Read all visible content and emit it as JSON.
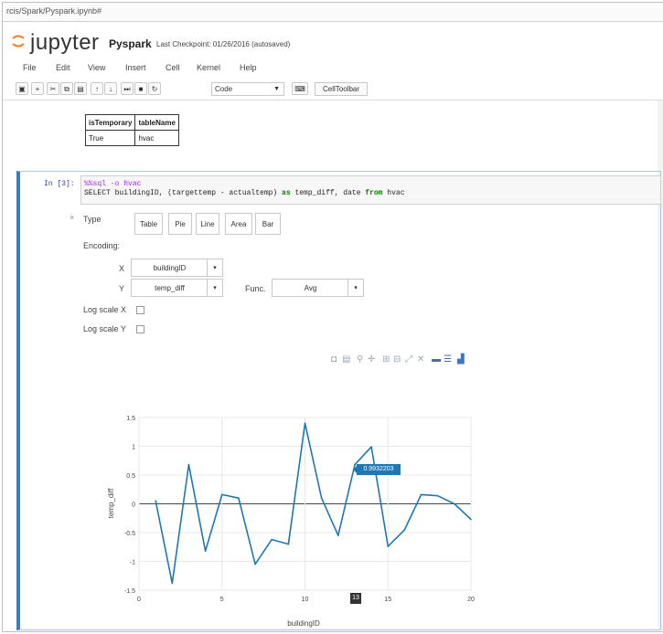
{
  "browser": {
    "url": "rcis/Spark/Pyspark.ipynb#"
  },
  "header": {
    "logo_text": "jupyter",
    "notebook_name": "Pyspark",
    "checkpoint": "Last Checkpoint: 01/26/2016 (autosaved)"
  },
  "menu": [
    "File",
    "Edit",
    "View",
    "Insert",
    "Cell",
    "Kernel",
    "Help"
  ],
  "toolbar": {
    "cell_type": "Code",
    "celltoolbar_label": "CellToolbar"
  },
  "prev_output_table": {
    "headers": [
      "isTemporary",
      "tableName"
    ],
    "rows": [
      [
        "True",
        "hvac"
      ]
    ]
  },
  "cell": {
    "prompt": "In [3]:",
    "code_magic": "%%sql -o hvac",
    "code_line2_a": "SELECT buildingID, (targettemp - actualtemp) ",
    "code_line2_as": "as",
    "code_line2_b": " temp_diff, date ",
    "code_line2_from": "from",
    "code_line2_c": " hvac"
  },
  "widget": {
    "type_label": "Type",
    "type_buttons": [
      "Table",
      "Pie",
      "Line",
      "Area",
      "Bar"
    ],
    "encoding_label": "Encoding:",
    "x_label": "X",
    "x_value": "buildingID",
    "y_label": "Y",
    "y_value": "temp_diff",
    "func_label": "Func.",
    "func_value": "Avg",
    "log_x_label": "Log scale X",
    "log_y_label": "Log scale Y"
  },
  "chart_data": {
    "type": "line",
    "title": "",
    "xlabel": "buildingID",
    "ylabel": "temp_diff",
    "xlim": [
      0,
      20
    ],
    "ylim": [
      -1.5,
      1.5
    ],
    "xticks": [
      "0",
      "5",
      "10",
      "15",
      "20"
    ],
    "yticks": [
      "1.5",
      "1",
      "0.5",
      "0",
      "-0.5",
      "-1",
      "-1.5"
    ],
    "grid": true,
    "color": "#1f77b4",
    "series": [
      {
        "x": [
          1,
          2,
          3,
          4,
          5,
          6,
          7,
          8,
          9,
          10,
          11,
          12,
          13,
          14,
          15,
          16,
          17,
          18,
          19,
          20
        ],
        "values": [
          0.05,
          -1.38,
          0.68,
          -0.82,
          0.16,
          0.1,
          -1.05,
          -0.62,
          -0.7,
          1.4,
          0.1,
          -0.55,
          0.68,
          0.99,
          -0.74,
          -0.45,
          0.16,
          0.14,
          0.0,
          -0.27
        ]
      }
    ],
    "hover_label": "0.9932203",
    "hover_x_label": "13"
  }
}
